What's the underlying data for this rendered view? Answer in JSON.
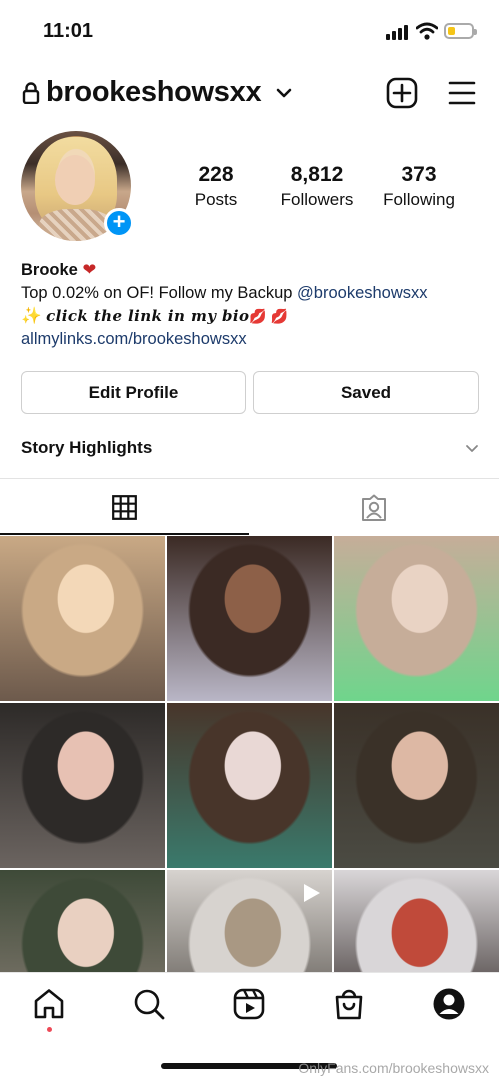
{
  "status_bar": {
    "time": "11:01",
    "signal-icon": "cellular-signal-icon",
    "wifi-icon": "wifi-icon",
    "battery_level": 0.3,
    "battery_color": "#f5c518"
  },
  "header": {
    "username": "brookeshowsxx",
    "lock-icon": "lock-icon",
    "switch-icon": "chevron-down-icon",
    "new-post-icon": "plus-square-icon",
    "menu-icon": "hamburger-menu-icon"
  },
  "profile": {
    "stats": [
      {
        "count": "228",
        "label": "Posts"
      },
      {
        "count": "8,812",
        "label": "Followers"
      },
      {
        "count": "373",
        "label": "Following"
      }
    ],
    "add_story_glyph": "+"
  },
  "bio": {
    "name": "Brooke",
    "name_emoji": "❤",
    "line1_text": "Top 0.02% on OF! Follow my Backup ",
    "line1_mention": "@brookeshowsxx",
    "line2_sparkle": "✨",
    "line2_text": "click the link in my bio",
    "line2_emoji": "💋 💋",
    "link": "allmylinks.com/brookeshowsxx"
  },
  "buttons": {
    "edit_profile": "Edit Profile",
    "saved": "Saved"
  },
  "highlights": {
    "title": "Story Highlights",
    "chevron-icon": "chevron-down-icon"
  },
  "tabs": [
    {
      "name": "posts",
      "icon": "grid-icon",
      "active": true
    },
    {
      "name": "tagged",
      "icon": "tagged-person-icon",
      "active": false
    }
  ],
  "grid": {
    "photos": [
      {
        "colors": [
          "#c9a985",
          "#f3d8b8",
          "#6d5a4c"
        ],
        "reel": false
      },
      {
        "colors": [
          "#3b2a24",
          "#8d6048",
          "#b9b6c6"
        ],
        "reel": false
      },
      {
        "colors": [
          "#c6ad99",
          "#e9d3c4",
          "#6fd58c"
        ],
        "reel": false
      },
      {
        "colors": [
          "#2d2a28",
          "#e7c1b3",
          "#6b6460"
        ],
        "reel": false
      },
      {
        "colors": [
          "#48352a",
          "#e9d8d5",
          "#3a7a6c"
        ],
        "reel": false
      },
      {
        "colors": [
          "#3a3128",
          "#ddb8a4",
          "#4b4b43"
        ],
        "reel": false
      },
      {
        "colors": [
          "#3e4a38",
          "#e9d0c1",
          "#8a7f76"
        ],
        "reel": false
      },
      {
        "colors": [
          "#d7d3cf",
          "#a99883",
          "#4f4a44"
        ],
        "reel": true
      },
      {
        "colors": [
          "#d9d6d8",
          "#c04a3a",
          "#2b2220"
        ],
        "reel": false
      }
    ]
  },
  "bottom_nav": {
    "items": [
      "home-icon",
      "search-icon",
      "reels-icon",
      "shop-icon",
      "profile-icon"
    ],
    "notification_dot_color": "#ed4956"
  },
  "watermark": "OnlyFans.com/brookeshowsxx"
}
